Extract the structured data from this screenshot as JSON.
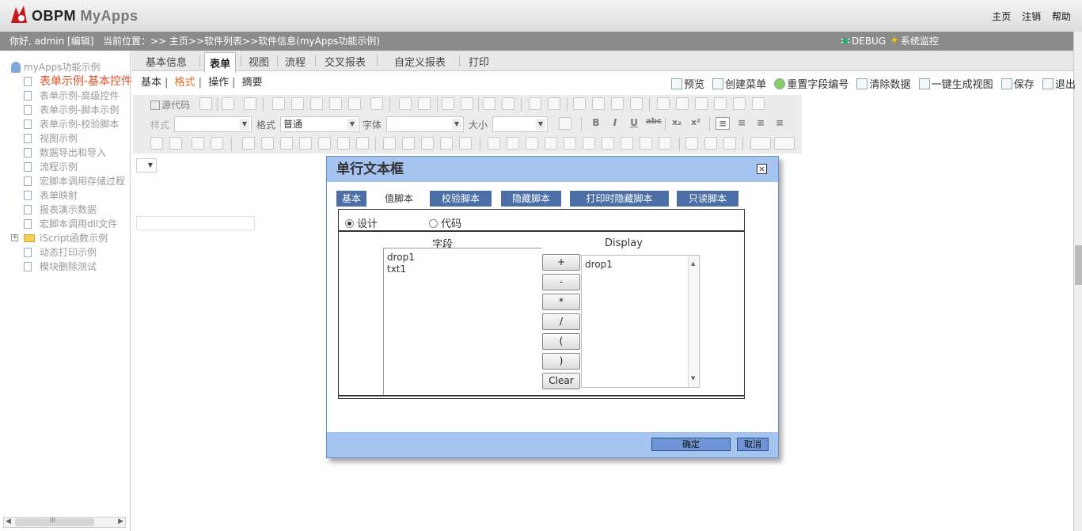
{
  "header": {
    "app_brand": "OBPM",
    "app_name": "MyApps",
    "links": [
      "主页",
      "注销",
      "帮助"
    ]
  },
  "infobar": {
    "greeting": "你好, admin [编辑]",
    "location": "当前位置：>> 主页>>软件列表>>软件信息(myApps功能示例)",
    "debug": "DEBUG",
    "monitor": "系统监控"
  },
  "sidebar": {
    "root": "myApps功能示例",
    "items": [
      "表单示例-基本控件",
      "表单示例-高级控件",
      "表单示例-脚本示例",
      "表单示例-校验脚本",
      "视图示例",
      "数据导出和导入",
      "流程示例",
      "宏脚本调用存储过程",
      "表单映射",
      "报表演示数据",
      "宏脚本调用dll文件"
    ],
    "folder": "iScript函数示例",
    "items2": [
      "动态打印示例",
      "模块删除测试"
    ],
    "hscroll_label": "III"
  },
  "tabs": [
    "基本信息",
    "表单",
    "视图",
    "流程",
    "交叉报表",
    "自定义报表",
    "打印"
  ],
  "subtabs": [
    "基本",
    "格式",
    "操作",
    "摘要"
  ],
  "actions": [
    "预览",
    "创建菜单",
    "重置字段编号",
    "清除数据",
    "一键生成视图",
    "保存",
    "退出"
  ],
  "toolbar": {
    "source": "源代码",
    "style_label": "样式",
    "format_label": "格式",
    "format_value": "普通",
    "font_label": "字体",
    "size_label": "大小"
  },
  "dialog": {
    "title": "单行文本框",
    "tabs": [
      "基本",
      "值脚本",
      "校验脚本",
      "隐藏脚本",
      "打印时隐藏脚本",
      "只读脚本"
    ],
    "radio_design": "设计",
    "radio_code": "代码",
    "field_header": "字段",
    "display_header": "Display",
    "fields": [
      "drop1",
      "txt1"
    ],
    "operators": [
      "+",
      "-",
      "*",
      "/",
      "(",
      ")",
      "Clear"
    ],
    "display_value": "drop1",
    "ok": "确定",
    "cancel": "取消"
  },
  "colors": {
    "infobar": "#8b8b8b",
    "dialog_header": "#a6c4f0",
    "tab_active_text": "#e06b2a",
    "tree_active": "#e0502a"
  }
}
